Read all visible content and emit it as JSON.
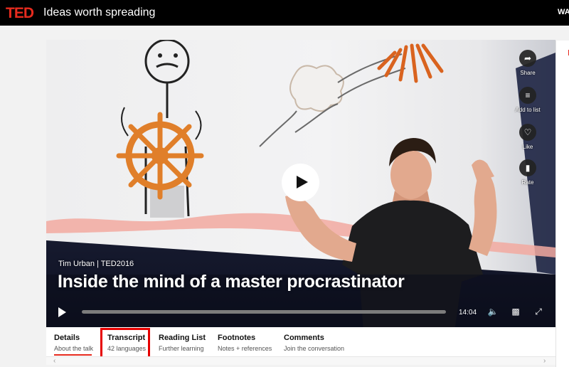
{
  "header": {
    "logo": "TED",
    "tagline": "Ideas worth spreading",
    "nav_partial": "WA"
  },
  "video": {
    "speaker_line": "Tim Urban | TED2016",
    "title": "Inside the mind of a master procrastinator",
    "time": "14:04",
    "progress": 0.0,
    "actions": [
      {
        "label": "Share",
        "icon": "share-icon"
      },
      {
        "label": "Add to list",
        "icon": "add-to-list-icon"
      },
      {
        "label": "Like",
        "icon": "heart-icon"
      },
      {
        "label": "Rate",
        "icon": "bar-chart-icon"
      }
    ],
    "control_icons": [
      "play-icon",
      "volume-icon",
      "subtitles-icon",
      "fullscreen-icon"
    ]
  },
  "tabs": [
    {
      "name": "Details",
      "sub": "About the talk",
      "active": true
    },
    {
      "name": "Transcript",
      "sub": "42 languages",
      "highlighted": true
    },
    {
      "name": "Reading List",
      "sub": "Further learning"
    },
    {
      "name": "Footnotes",
      "sub": "Notes + references"
    },
    {
      "name": "Comments",
      "sub": "Join the conversation"
    }
  ],
  "colors": {
    "brand_red": "#e62b1e",
    "highlight_red": "#e60000",
    "topbar": "#000000",
    "video_dark": "#141827"
  }
}
